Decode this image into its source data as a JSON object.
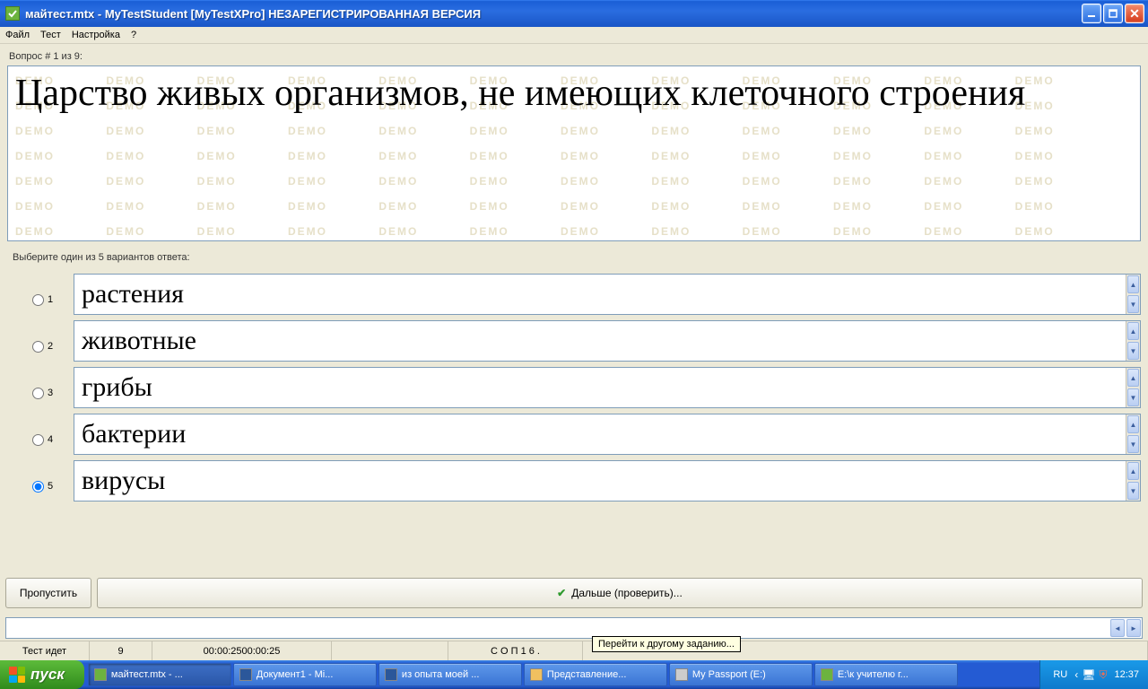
{
  "window": {
    "title": "майтест.mtx - MyTestStudent [MyTestXPro] НЕЗАРЕГИСТРИРОВАННАЯ ВЕРСИЯ"
  },
  "menu": {
    "file": "Файл",
    "test": "Тест",
    "settings": "Настройка",
    "help": "?"
  },
  "question": {
    "counter_label": "Вопрос # 1 из 9:",
    "text": "Царство живых организмов, не имеющих клеточного строения",
    "watermark": "DEMO DEMO DEMO DEMO DEMO DEMO DEMO DEMO DEMO DEMO DEMO DEMO DEMO DEMO DEMO DEMO DEMO DEMO DEMO DEMO DEMO DEMO DEMO DEMO DEMO DEMO DEMO DEMO DEMO DEMO DEMO DEMO DEMO DEMO DEMO DEMO DEMO DEMO DEMO DEMO DEMO DEMO DEMO DEMO DEMO DEMO DEMO DEMO DEMO DEMO DEMO DEMO DEMO DEMO DEMO DEMO DEMO DEMO DEMO DEMO DEMO DEMO DEMO DEMO DEMO DEMO DEMO DEMO DEMO DEMO DEMO DEMO DEMO DEMO DEMO DEMO DEMO DEMO DEMO DEMO DEMO DEMO DEMO DEMO DEMO DEMO DEMO DEMO DEMO DEMO DEMO"
  },
  "instruction": "Выберите один из 5 вариантов ответа:",
  "answers": [
    {
      "num": "1",
      "text": "растения",
      "selected": false
    },
    {
      "num": "2",
      "text": "животные",
      "selected": false
    },
    {
      "num": "3",
      "text": "грибы",
      "selected": false
    },
    {
      "num": "4",
      "text": "бактерии",
      "selected": false
    },
    {
      "num": "5",
      "text": "вирусы",
      "selected": true
    }
  ],
  "nav": {
    "skip": "Пропустить",
    "next": "Дальше (проверить)..."
  },
  "status": {
    "running": "Тест идет",
    "count": "9",
    "time": "00:00:2500:00:25",
    "letters": "С  О  П   1 6 .",
    "tooltip": "Перейти к другому заданию..."
  },
  "taskbar": {
    "start": "пуск",
    "items": [
      {
        "label": "майтест.mtx - ...",
        "active": true,
        "icon_color": "#6cb33f"
      },
      {
        "label": "Документ1 - Mi...",
        "active": false,
        "icon_color": "#2b579a"
      },
      {
        "label": "из опыта моей ...",
        "active": false,
        "icon_color": "#2b579a"
      },
      {
        "label": "Представление...",
        "active": false,
        "icon_color": "#f0c060"
      },
      {
        "label": "My Passport (E:)",
        "active": false,
        "icon_color": "#cccccc"
      },
      {
        "label": "E:\\к учителю г...",
        "active": false,
        "icon_color": "#6cb33f"
      }
    ],
    "lang": "RU",
    "clock": "12:37"
  }
}
